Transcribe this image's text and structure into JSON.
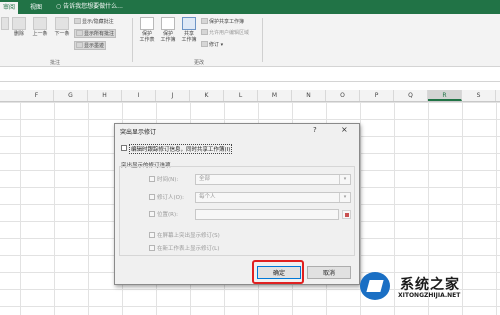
{
  "tabs": [
    "审阅",
    "视图"
  ],
  "tell_me": "告诉我您想要做什么...",
  "ribbon": {
    "comments_group": {
      "label": "批注",
      "buttons": [
        "删除",
        "上一条",
        "下一条"
      ],
      "small_buttons": [
        "显示/隐藏批注",
        "显示所有批注",
        "显示墨迹"
      ]
    },
    "changes_group": {
      "label": "更改",
      "buttons": [
        "保护\n工作表",
        "保护\n工作簿",
        "共享\n工作簿"
      ],
      "small_buttons": [
        "保护共享工作簿",
        "允许用户编辑区域",
        "修订 ▾"
      ]
    }
  },
  "columns": [
    "F",
    "G",
    "H",
    "I",
    "J",
    "K",
    "L",
    "M",
    "N",
    "O",
    "P",
    "Q",
    "R",
    "S"
  ],
  "selected_column": "R",
  "dialog": {
    "title": "突出显示修订",
    "help": "?",
    "close": "×",
    "track_changes_label": "编辑时跟踪修订信息，同时共享工作簿(I)",
    "group_title": "突出显示的修订选项",
    "when_label": "时间(N):",
    "when_value": "全部",
    "who_label": "修订人(O):",
    "who_value": "每个人",
    "where_label": "位置(R):",
    "where_value": "",
    "on_screen_label": "在屏幕上突出显示修订(S)",
    "on_new_sheet_label": "在新工作表上显示修订(L)",
    "ok": "确定",
    "cancel": "取消"
  },
  "watermark": {
    "cn": "系统之家",
    "en": "XITONGZHIJIA.NET"
  }
}
